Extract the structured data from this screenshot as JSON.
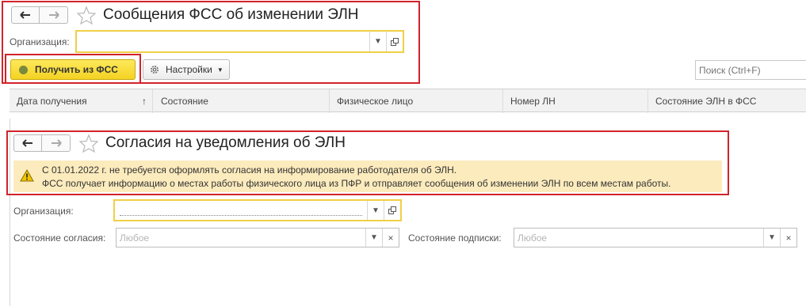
{
  "fss_form": {
    "title": "Сообщения ФСС об изменении ЭЛН",
    "org_label": "Организация:",
    "org_value": "",
    "get_button": "Получить из ФСС",
    "settings_button": "Настройки",
    "search_placeholder": "Поиск (Ctrl+F)",
    "columns": [
      "Дата получения",
      "Состояние",
      "Физическое лицо",
      "Номер ЛН",
      "Состояние ЭЛН в ФСС"
    ],
    "sort_arrow": "↑"
  },
  "consent_form": {
    "title": "Согласия на уведомления об ЭЛН",
    "warning_line1": "С 01.01.2022 г. не требуется оформлять согласия на информирование работодателя об ЭЛН.",
    "warning_line2": "ФСС получает информацию о местах работы физического лица из ПФР и отправляет сообщения об изменении ЭЛН по всем местам работы.",
    "org_label": "Организация:",
    "org_value": "",
    "consent_state_label": "Состояние согласия:",
    "consent_state_placeholder": "Любое",
    "sign_state_label": "Состояние подписки:",
    "sign_state_placeholder": "Любое"
  },
  "colors": {
    "highlight_border": "#d2232a",
    "primary_button": "#f4d222",
    "warning_bg": "#fcebbd",
    "field_focus": "#f0cf47"
  }
}
